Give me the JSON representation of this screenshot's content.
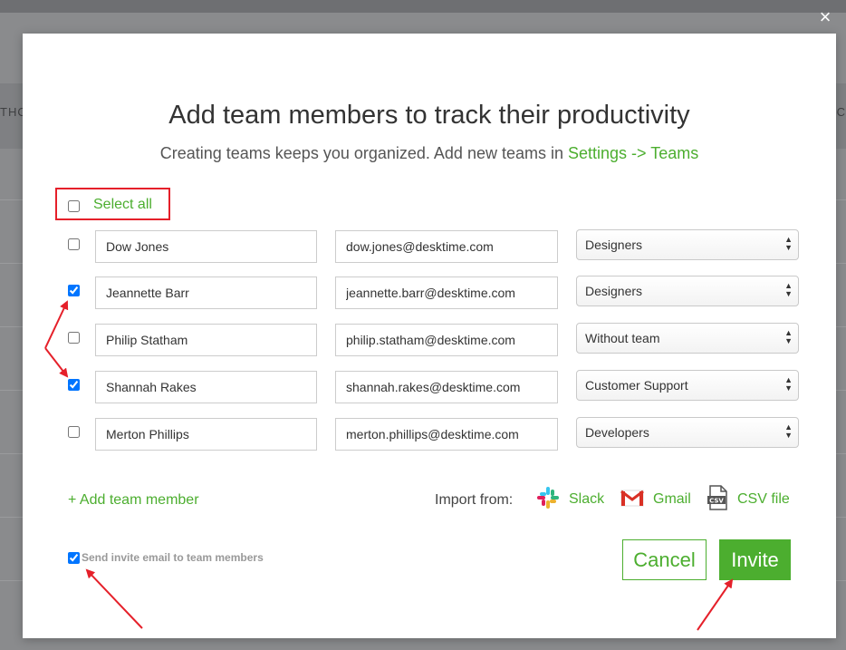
{
  "background": {
    "left_fragment": "THO",
    "right_fragment": "AC"
  },
  "close_glyph": "×",
  "modal": {
    "title": "Add team members to track their productivity",
    "subtitle_prefix": "Creating teams keeps you organized. Add new teams in ",
    "subtitle_link": "Settings -> Teams",
    "select_all_label": "Select all",
    "select_all_checked": false,
    "members": [
      {
        "name": "Dow Jones",
        "email": "dow.jones@desktime.com",
        "team": "Designers",
        "checked": false
      },
      {
        "name": "Jeannette Barr",
        "email": "jeannette.barr@desktime.com",
        "team": "Designers",
        "checked": true
      },
      {
        "name": "Philip Statham",
        "email": "philip.statham@desktime.com",
        "team": "Without team",
        "checked": false
      },
      {
        "name": "Shannah Rakes",
        "email": "shannah.rakes@desktime.com",
        "team": "Customer Support",
        "checked": true
      },
      {
        "name": "Merton Phillips",
        "email": "merton.phillips@desktime.com",
        "team": "Developers",
        "checked": false
      }
    ],
    "add_member_label": "+ Add team member",
    "import_label": "Import from:",
    "import_sources": [
      {
        "label": "Slack",
        "icon": "slack-icon"
      },
      {
        "label": "Gmail",
        "icon": "gmail-icon"
      },
      {
        "label": "CSV file",
        "icon": "csv-file-icon"
      }
    ],
    "send_invite_label": "Send invite email to team members",
    "send_invite_checked": true,
    "cancel_label": "Cancel",
    "invite_label": "Invite"
  },
  "colors": {
    "accent_green": "#4cae2f",
    "annotation_red": "#e5202a",
    "overlay": "#8a8b8d"
  }
}
